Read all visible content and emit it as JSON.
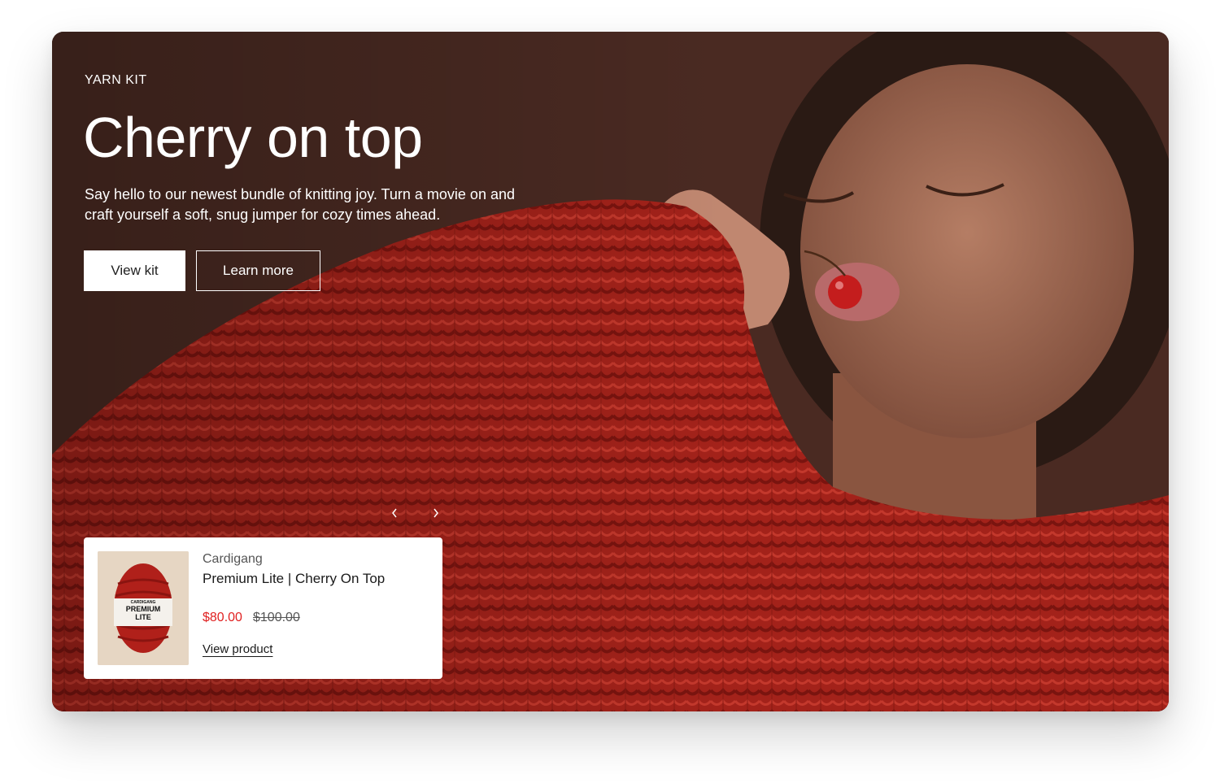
{
  "hero": {
    "eyebrow": "YARN KIT",
    "title": "Cherry on top",
    "description": "Say hello to our newest bundle of knitting joy. Turn a movie on and craft yourself a soft, snug jumper for cozy times ahead.",
    "primary_button": "View kit",
    "secondary_button": "Learn more",
    "colors": {
      "background": "#4a2a22",
      "sweater": "#a82219",
      "text": "#ffffff"
    }
  },
  "carousel": {
    "prev_icon": "chevron-left-icon",
    "next_icon": "chevron-right-icon"
  },
  "product": {
    "vendor": "Cardigang",
    "title": "Premium Lite | Cherry On Top",
    "sale_price": "$80.00",
    "compare_price": "$100.00",
    "link_label": "View product",
    "thumbnail_label_brand": "CARDIGANG",
    "thumbnail_label_line1": "PREMIUM",
    "thumbnail_label_line2": "LITE",
    "colors": {
      "sale": "#e02020",
      "yarn": "#b0201a"
    }
  }
}
